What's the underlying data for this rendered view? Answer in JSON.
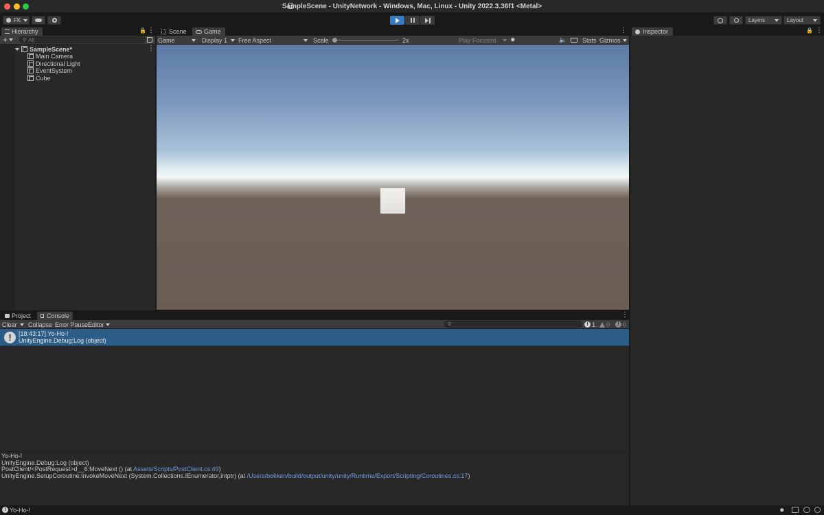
{
  "window": {
    "title": "SampleScene - UnityNetwork - Windows, Mac, Linux - Unity 2022.3.36f1 <Metal>",
    "traffic_colors": [
      "#ff5f57",
      "#febc2e",
      "#28c840"
    ]
  },
  "toolbar": {
    "account": "FK",
    "layers": "Layers",
    "layout": "Layout",
    "play_color": "#3a7abf"
  },
  "hierarchy": {
    "tab": "Hierarchy",
    "search_placeholder": "All",
    "scene": "SampleScene*",
    "items": [
      {
        "label": "Main Camera"
      },
      {
        "label": "Directional Light"
      },
      {
        "label": "EventSystem"
      },
      {
        "label": "Cube"
      }
    ]
  },
  "center": {
    "tabs": [
      {
        "label": "Scene"
      },
      {
        "label": "Game"
      }
    ],
    "toolbar": {
      "mode": "Game",
      "display": "Display 1",
      "aspect": "Free Aspect",
      "scale_label": "Scale",
      "scale_value": "2x",
      "play_focused": "Play Focused",
      "stats": "Stats",
      "gizmos": "Gizmos"
    }
  },
  "inspector": {
    "tab": "Inspector"
  },
  "bottom": {
    "tabs": [
      {
        "label": "Project"
      },
      {
        "label": "Console"
      }
    ],
    "toolbar": {
      "clear": "Clear",
      "collapse": "Collapse",
      "error_pause": "Error Pause",
      "editor": "Editor",
      "count_info": "1",
      "count_warn": "0",
      "count_error": "0"
    },
    "log_entry": {
      "line1": "[18:43:17] Yo-Ho-!",
      "line2": "UnityEngine.Debug:Log (object)"
    },
    "details": {
      "line1": "Yo-Ho-!",
      "line2": "UnityEngine.Debug:Log (object)",
      "line3_prefix": "PostClient/<PostRequest>d__6:MoveNext () (at ",
      "line3_link": "Assets/Scripts/PostClient.cs:49",
      "line3_suffix": ")",
      "line4_prefix": "UnityEngine.SetupCoroutine:InvokeMoveNext (System.Collections.IEnumerator,intptr) (at ",
      "line4_link": "/Users/bokken/build/output/unity/unity/Runtime/Export/Scripting/Coroutines.cs:17",
      "line4_suffix": ")"
    }
  },
  "statusbar": {
    "message": "Yo-Ho-!"
  }
}
